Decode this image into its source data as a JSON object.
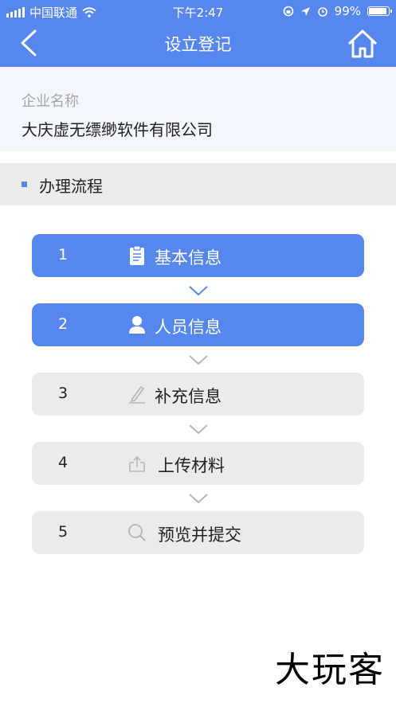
{
  "status_bar": {
    "carrier": "中国联通",
    "time": "下午2:47",
    "battery": "99%"
  },
  "nav": {
    "title": "设立登记",
    "back_icon": "chevron-left-icon",
    "home_icon": "home-icon"
  },
  "company": {
    "label": "企业名称",
    "name": "大庆虚无缥缈软件有限公司"
  },
  "flow": {
    "heading": "办理流程",
    "steps": [
      {
        "num": "1",
        "label": "基本信息",
        "icon": "clipboard-icon",
        "state": "active"
      },
      {
        "num": "2",
        "label": "人员信息",
        "icon": "person-icon",
        "state": "active"
      },
      {
        "num": "3",
        "label": "补充信息",
        "icon": "pencil-icon",
        "state": "inactive"
      },
      {
        "num": "4",
        "label": "上传材料",
        "icon": "upload-icon",
        "state": "inactive"
      },
      {
        "num": "5",
        "label": "预览并提交",
        "icon": "search-icon",
        "state": "inactive"
      }
    ]
  },
  "colors": {
    "accent": "#5587ee",
    "inactive_bg": "#ebebeb",
    "arrow_active": "#5587ee",
    "arrow_inactive": "#b5b5b5"
  },
  "watermark": "大玩客"
}
